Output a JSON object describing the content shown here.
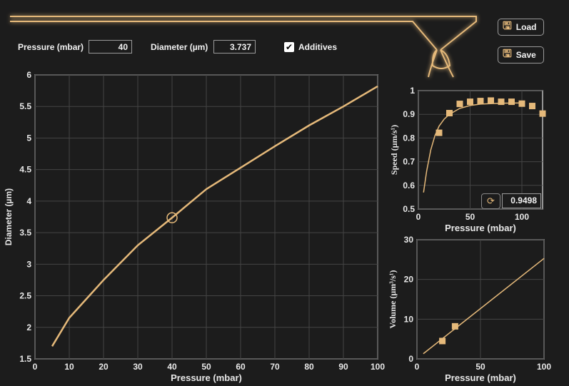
{
  "controls": {
    "pressure_label": "Pressure (mbar)",
    "pressure_value": "40",
    "diameter_label": "Diameter (µm)",
    "diameter_value": "3.737",
    "additives_label": "Additives",
    "additives_checked": true
  },
  "buttons": {
    "load": "Load",
    "save": "Save"
  },
  "colors": {
    "accent": "#e5b97a",
    "background": "#1c1c1c"
  },
  "fit_value": "0.9498",
  "chart_data": [
    {
      "type": "line",
      "xlabel": "Pressure (mbar)",
      "ylabel": "Diameter (µm)",
      "xlim": [
        0,
        100
      ],
      "ylim": [
        1.5,
        6
      ],
      "grid": true,
      "xticks": [
        "0",
        "10",
        "20",
        "30",
        "40",
        "50",
        "60",
        "70",
        "80",
        "90",
        "100"
      ],
      "yticks": [
        "1.5",
        "2",
        "2.5",
        "3",
        "3.5",
        "4",
        "4.5",
        "5",
        "5.5",
        "6"
      ],
      "x": [
        5,
        10,
        20,
        30,
        40,
        50,
        60,
        70,
        80,
        90,
        100
      ],
      "y": [
        1.7,
        2.15,
        2.75,
        3.3,
        3.737,
        4.19,
        4.53,
        4.87,
        5.2,
        5.5,
        5.82
      ],
      "marker": {
        "x": 40,
        "y": 3.737
      }
    },
    {
      "type": "scatter",
      "xlabel": "Pressure (mbar)",
      "ylabel": "Speed (µm/s¹)",
      "xlim": [
        0,
        120
      ],
      "ylim": [
        0.5,
        1
      ],
      "grid": true,
      "xticks": [
        "0",
        "50",
        "100"
      ],
      "yticks": [
        "0.5",
        "0.6",
        "0.7",
        "0.8",
        "0.9",
        "1"
      ],
      "points": {
        "x": [
          20,
          30,
          40,
          50,
          60,
          70,
          80,
          90,
          100,
          110,
          120
        ],
        "y": [
          0.822,
          0.905,
          0.944,
          0.953,
          0.956,
          0.958,
          0.953,
          0.953,
          0.945,
          0.935,
          0.903
        ]
      },
      "fit": {
        "x": [
          5,
          8,
          12,
          16,
          20,
          25,
          30,
          40,
          50,
          60,
          80,
          100
        ],
        "y": [
          0.57,
          0.66,
          0.75,
          0.81,
          0.85,
          0.88,
          0.9,
          0.925,
          0.937,
          0.943,
          0.947,
          0.948
        ]
      }
    },
    {
      "type": "scatter",
      "xlabel": "Pressure (mbar)",
      "ylabel": "Volume (µm³/s¹)",
      "xlim": [
        0,
        100
      ],
      "ylim": [
        0,
        30
      ],
      "grid": true,
      "xticks": [
        "0",
        "50",
        "100"
      ],
      "yticks": [
        "0",
        "10",
        "20",
        "30"
      ],
      "points": {
        "x": [
          20,
          30
        ],
        "y": [
          4.5,
          8.2
        ]
      },
      "fit": {
        "x": [
          5,
          100
        ],
        "y": [
          1.3,
          25.3
        ]
      }
    }
  ]
}
